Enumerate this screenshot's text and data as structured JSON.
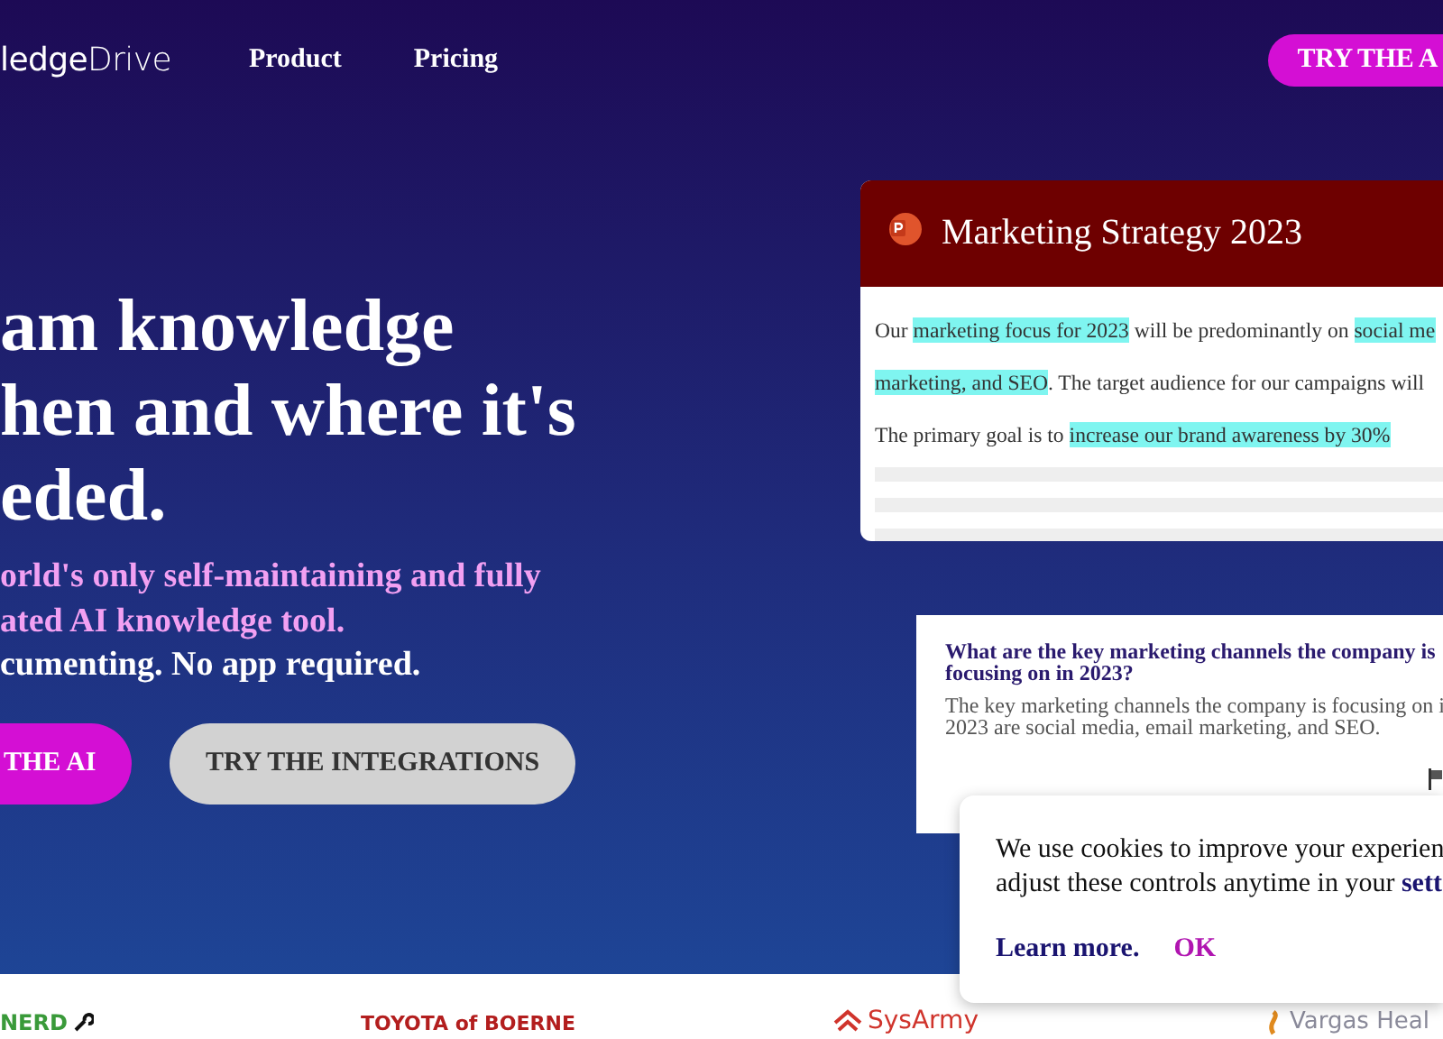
{
  "header": {
    "logo": "**ledge**Drive",
    "nav": [
      {
        "label": "Product"
      },
      {
        "label": "Pricing"
      }
    ],
    "cta": "TRY THE A"
  },
  "hero": {
    "headline": [
      "am knowledge",
      "hen and where it's",
      "eded."
    ],
    "subtitle": [
      "orld's only self-maintaining and fully",
      "ated AI knowledge tool."
    ],
    "tagline": "cumenting. No app required.",
    "buttons": [
      {
        "label": "THE AI",
        "kind": "primary"
      },
      {
        "label": "TRY THE INTEGRATIONS",
        "kind": "secondary"
      }
    ]
  },
  "document_card": {
    "title": "Marketing Strategy 2023",
    "lines": [
      [
        {
          "text": "Our ",
          "highlighted": false
        },
        {
          "text": "marketing focus for 2023",
          "highlighted": true
        },
        {
          "text": " will be predominantly on ",
          "highlighted": false
        },
        {
          "text": "social me",
          "highlighted": true
        }
      ],
      [
        {
          "text": "marketing, and SEO",
          "highlighted": true
        },
        {
          "text": ". The target audience for our campaigns will",
          "highlighted": false
        }
      ],
      [
        {
          "text": "The primary goal is to ",
          "highlighted": false
        },
        {
          "text": "increase our brand awareness by 30%",
          "highlighted": true
        }
      ]
    ]
  },
  "qa_card": {
    "question": "What are the key marketing channels the company is focusing on in 2023?",
    "answer": [
      "The key marketing channels the company is focusing on i",
      "2023 are social media, email marketing, and SEO."
    ]
  },
  "cookie_banner": {
    "lines": [
      "We use cookies to improve your experien",
      "adjust these controls anytime in your"
    ],
    "link": "sett",
    "learn_more": "Learn more.",
    "ok": "OK"
  },
  "logos": [
    {
      "text": "NERD",
      "kind": "wrench"
    },
    {
      "text": "TOYOTA of BOERNE",
      "kind": "plain"
    },
    {
      "text": "SysArmy",
      "kind": "house"
    },
    {
      "text": "Vargas Heal",
      "kind": "swirl"
    }
  ]
}
